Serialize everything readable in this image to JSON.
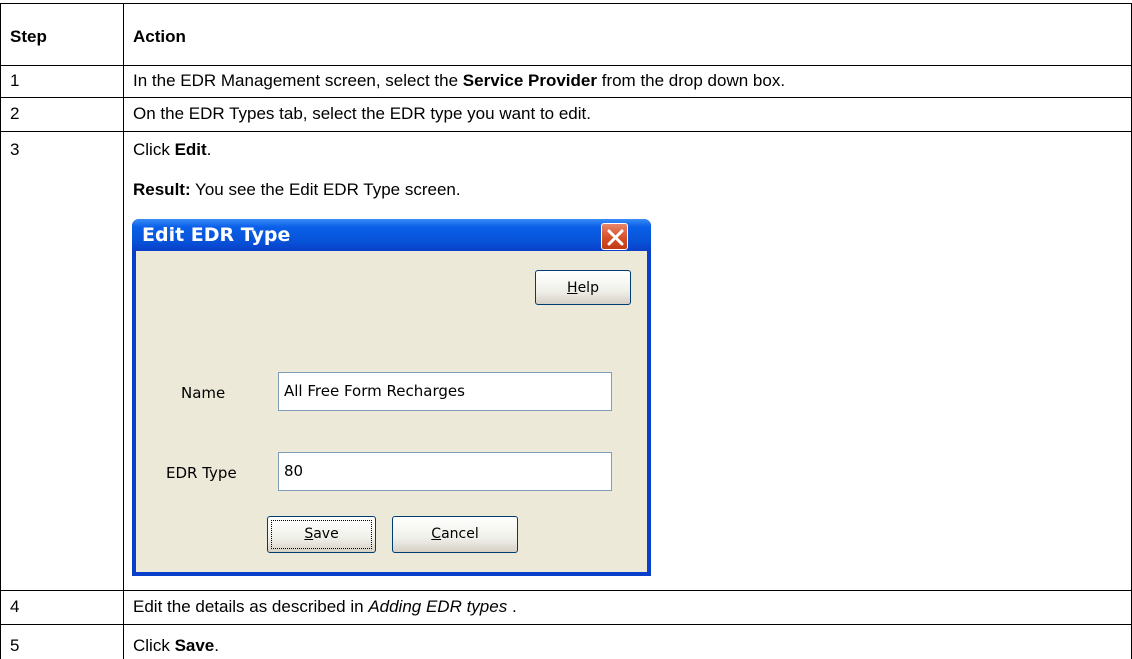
{
  "table": {
    "headers": {
      "step": "Step",
      "action": "Action"
    },
    "rows": [
      {
        "step": "1",
        "pre": "In the EDR Management screen, select the ",
        "bold": "Service Provider",
        "post": " from the drop down box."
      },
      {
        "step": "2",
        "text": "On the EDR Types tab, select the EDR type you want to edit."
      },
      {
        "step": "3",
        "click_pre": "Click ",
        "click_bold": "Edit",
        "click_post": ".",
        "result_label": "Result:",
        "result_text": " You see the Edit EDR Type screen."
      },
      {
        "step": "4",
        "pre": "Edit the details as described in ",
        "italic": "Adding EDR types",
        "post": " ."
      },
      {
        "step": "5",
        "pre": "Click ",
        "bold": "Save",
        "post": "."
      }
    ]
  },
  "dialog": {
    "title": "Edit EDR Type",
    "close_icon": "close-x-icon",
    "help": {
      "pre": "",
      "mnemonic": "H",
      "post": "elp"
    },
    "name_label": "Name",
    "name_value": "All Free Form Recharges",
    "edr_type_label": "EDR Type",
    "edr_type_value": "80",
    "save": {
      "mnemonic": "S",
      "post": "ave"
    },
    "cancel": {
      "mnemonic": "C",
      "post": "ancel"
    }
  }
}
